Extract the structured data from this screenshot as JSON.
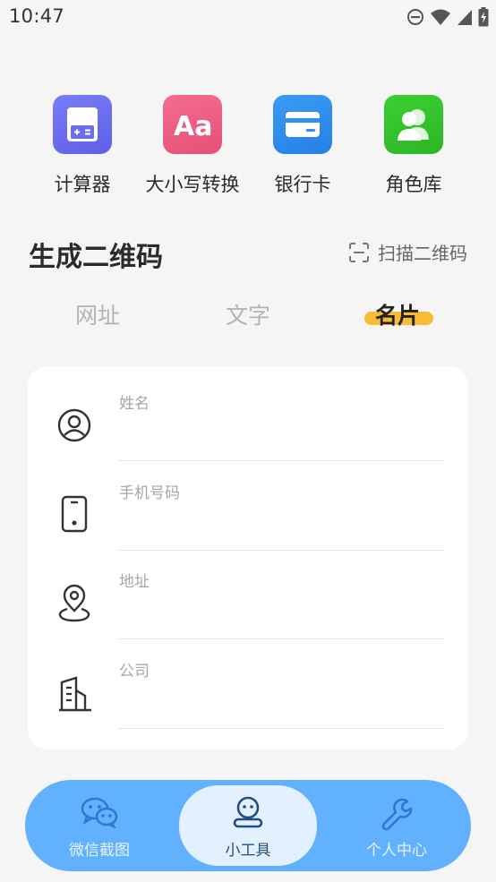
{
  "status_bar": {
    "time": "10:47",
    "icons": [
      "dnd-icon",
      "wifi-icon",
      "signal-icon",
      "battery-charging-icon"
    ]
  },
  "tools": [
    {
      "label": "计算器",
      "icon": "calculator-icon",
      "color": "#6b6ef2"
    },
    {
      "label": "大小写转换",
      "icon": "font-case-icon",
      "color": "#ee5a80"
    },
    {
      "label": "银行卡",
      "icon": "bank-card-icon",
      "color": "#2f8ef0"
    },
    {
      "label": "角色库",
      "icon": "people-icon",
      "color": "#35c52c"
    }
  ],
  "qr_section": {
    "title": "生成二维码",
    "scan_label": "扫描二维码",
    "tabs": [
      "网址",
      "文字",
      "名片"
    ],
    "active_tab": "名片"
  },
  "card_form": {
    "fields": [
      {
        "label": "姓名",
        "icon": "user-circle-icon",
        "value": ""
      },
      {
        "label": "手机号码",
        "icon": "phone-icon",
        "value": ""
      },
      {
        "label": "地址",
        "icon": "location-icon",
        "value": ""
      },
      {
        "label": "公司",
        "icon": "building-icon",
        "value": ""
      }
    ]
  },
  "bottom_nav": {
    "items": [
      {
        "label": "微信截图",
        "icon": "wechat-icon"
      },
      {
        "label": "小工具",
        "icon": "robot-icon"
      },
      {
        "label": "个人中心",
        "icon": "wrench-icon"
      }
    ],
    "active": "小工具"
  },
  "colors": {
    "accent_yellow": "#f7bc33",
    "nav_blue": "#62b1ff",
    "nav_active_bg": "#e3f0ff"
  }
}
